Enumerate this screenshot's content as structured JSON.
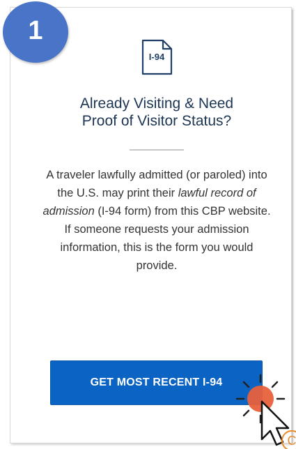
{
  "step": {
    "number": "1",
    "badge_color": "#4a74c8"
  },
  "card": {
    "icon": {
      "name": "document-icon",
      "label": "I-94"
    },
    "heading_line1": "Already Visiting & Need",
    "heading_line2": "Proof of Visitor Status?",
    "body": {
      "part1": "A traveler lawfully admitted (or paroled) into the U.S. may print their ",
      "italic": "lawful record of admission",
      "part2": " (I-94 form) from this CBP website. If someone requests your admission information, this is the form you would provide."
    },
    "button_label": "GET MOST RECENT I-94"
  },
  "overlay": {
    "cursor_icon": "pointer-arrow-icon",
    "click_indicator": "click-burst-icon",
    "click_color": "#e8603c",
    "copyright_symbol": "C"
  },
  "colors": {
    "heading": "#1c3552",
    "button": "#0b63c4",
    "button_text": "#ffffff",
    "divider": "#c8c8c8"
  }
}
